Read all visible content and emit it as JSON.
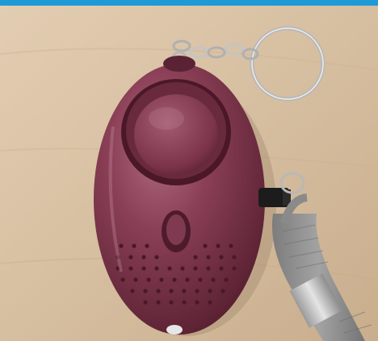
{
  "scene": {
    "accent_bar_color": "#1f9ad6",
    "table_color": "#d9c2a6",
    "device_color": "#6e2f43",
    "strap_color": "#8e8e8e",
    "icons": [
      "keyring-icon",
      "alarm-device-icon",
      "strap-icon"
    ]
  }
}
